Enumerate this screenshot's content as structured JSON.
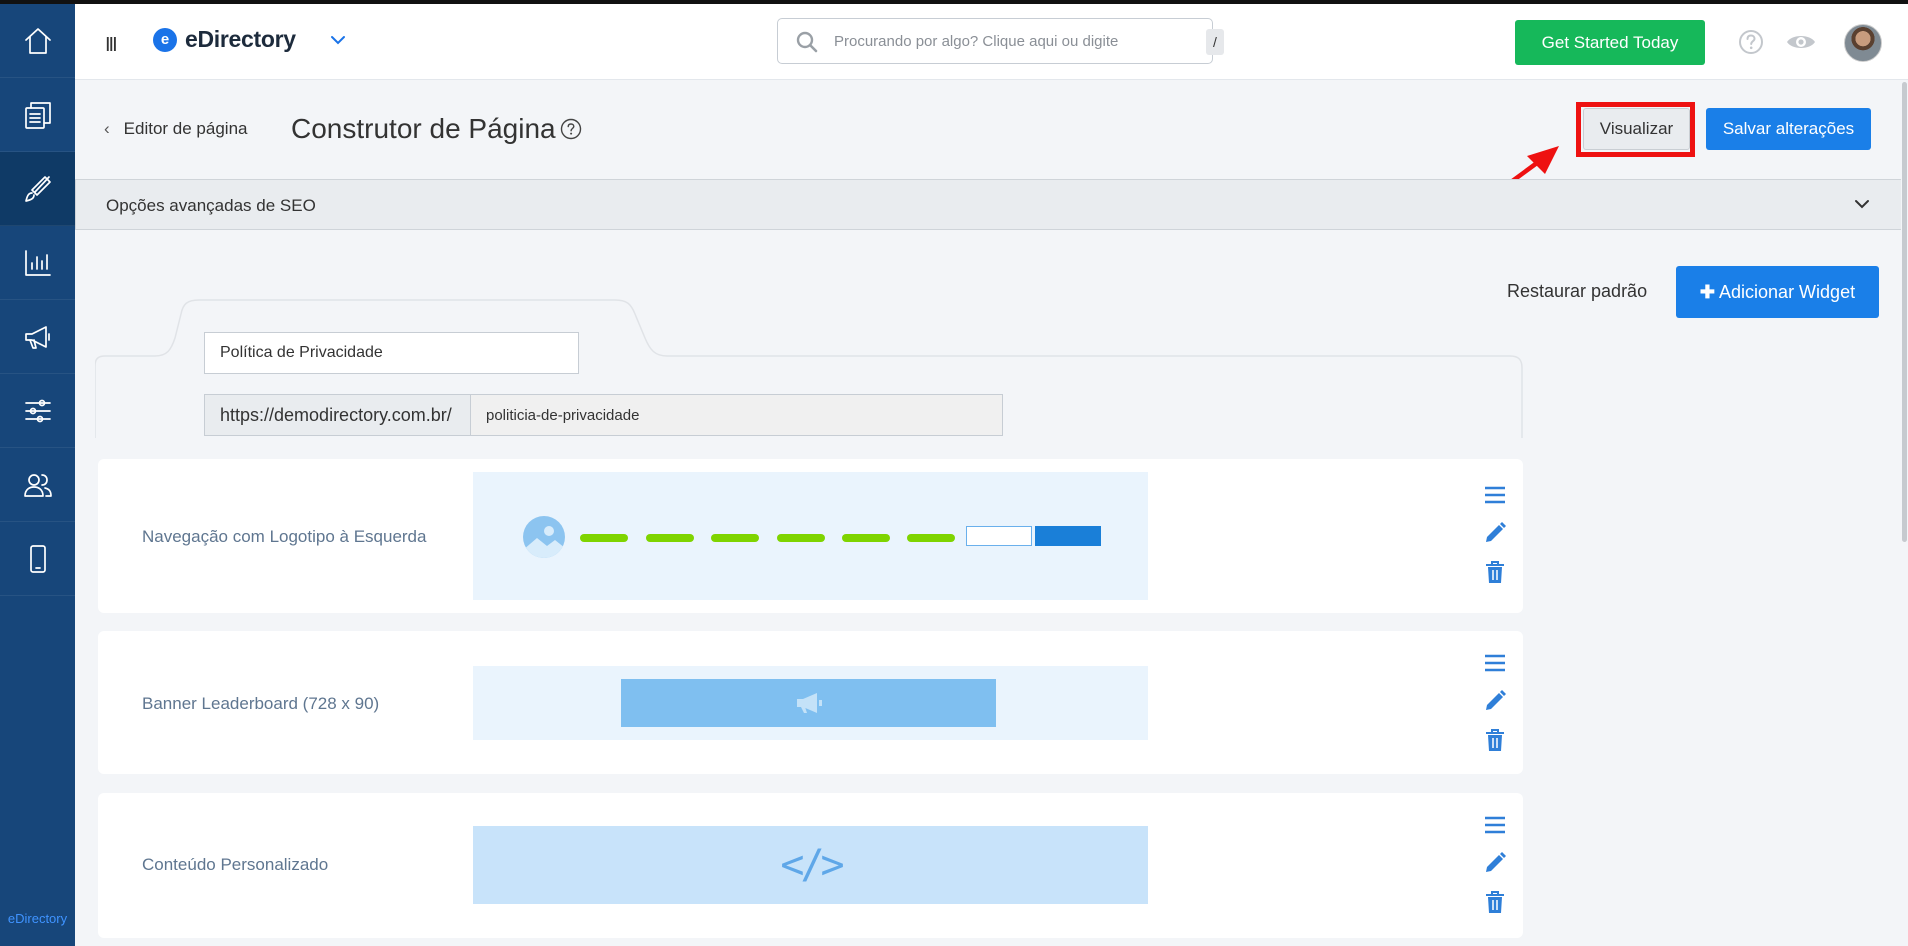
{
  "app": {
    "brand_name": "eDirectory",
    "sidebar_brand": "eDirectory",
    "menu_glyph": "III"
  },
  "sidebar": {
    "items": [
      {
        "name": "home-icon",
        "active": false
      },
      {
        "name": "content-icon",
        "active": false
      },
      {
        "name": "design-brush-icon",
        "active": true
      },
      {
        "name": "reports-chart-icon",
        "active": false
      },
      {
        "name": "promotion-megaphone-icon",
        "active": false
      },
      {
        "name": "settings-sliders-icon",
        "active": false
      },
      {
        "name": "users-icon",
        "active": false
      },
      {
        "name": "mobile-app-icon",
        "active": false
      }
    ]
  },
  "topbar": {
    "search_placeholder": "Procurando por algo? Clique aqui ou digite",
    "search_shortcut": "/",
    "get_started_label": "Get Started Today"
  },
  "header": {
    "back_label": "Editor de página",
    "page_title": "Construtor de Página",
    "preview_label": "Visualizar",
    "save_label": "Salvar alterações"
  },
  "seo": {
    "label": "Opções avançadas de SEO"
  },
  "actions": {
    "restore_label": "Restaurar padrão",
    "add_widget_label": "Adicionar Widget"
  },
  "page_form": {
    "name_value": "Política de Privacidade",
    "url_prefix": "https://demodirectory.com.br/",
    "url_slug": "politicia-de-privacidade"
  },
  "widgets": [
    {
      "label": "Navegação com Logotipo à Esquerda",
      "preview": "navigation"
    },
    {
      "label": "Banner Leaderboard (728 x 90)",
      "preview": "banner"
    },
    {
      "label": "Conteúdo Personalizado",
      "preview": "code",
      "preview_glyph": "</>"
    }
  ],
  "colors": {
    "sidebar_bg": "#17467a",
    "primary": "#1a7fe8",
    "success": "#16b85a",
    "highlight_red": "#ee1111",
    "nav_dash_green": "#7fd400"
  }
}
